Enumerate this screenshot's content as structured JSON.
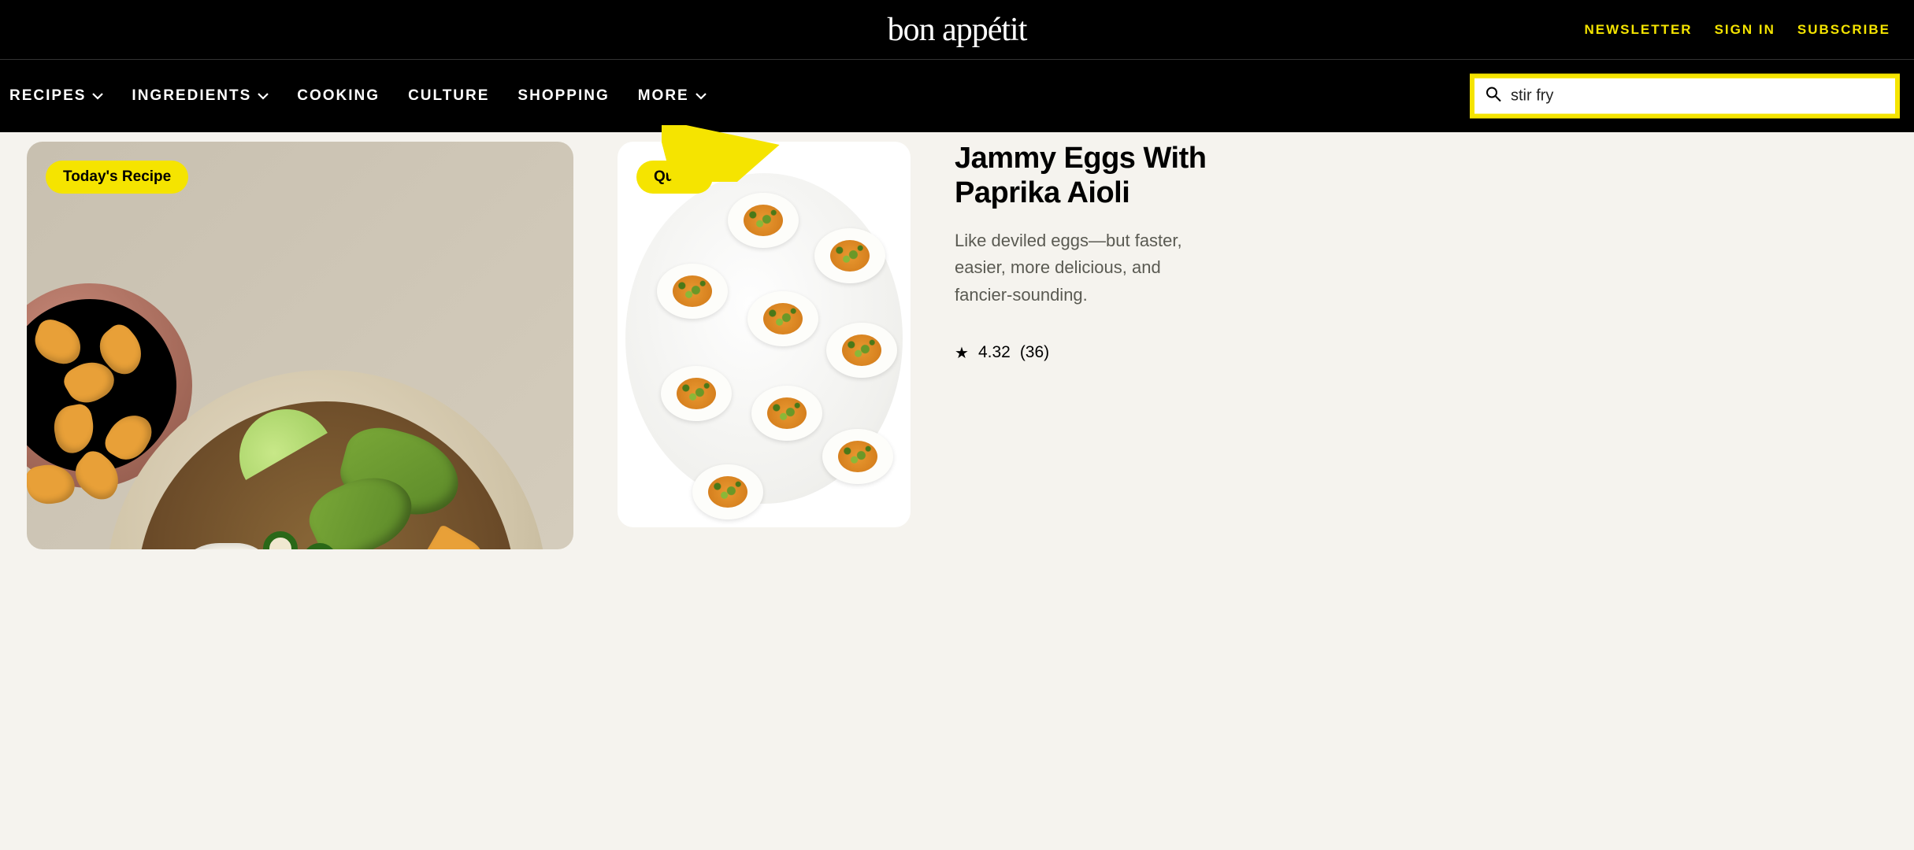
{
  "header": {
    "logo": "bon appétit",
    "links": {
      "newsletter": "NEWSLETTER",
      "signin": "SIGN IN",
      "subscribe": "SUBSCRIBE"
    }
  },
  "nav": {
    "items": [
      {
        "label": "RECIPES",
        "dropdown": true
      },
      {
        "label": "INGREDIENTS",
        "dropdown": true
      },
      {
        "label": "COOKING",
        "dropdown": false
      },
      {
        "label": "CULTURE",
        "dropdown": false
      },
      {
        "label": "SHOPPING",
        "dropdown": false
      },
      {
        "label": "MORE",
        "dropdown": true
      }
    ]
  },
  "search": {
    "value": "stir fry"
  },
  "cards": {
    "large": {
      "badge": "Today's Recipe"
    },
    "medium": {
      "badge": "Quick"
    }
  },
  "recipe": {
    "title": "Jammy Eggs With Paprika Aioli",
    "description": "Like deviled eggs—but faster, easier, more delicious, and fancier-sounding.",
    "rating": "4.32",
    "rating_count": "(36)"
  }
}
